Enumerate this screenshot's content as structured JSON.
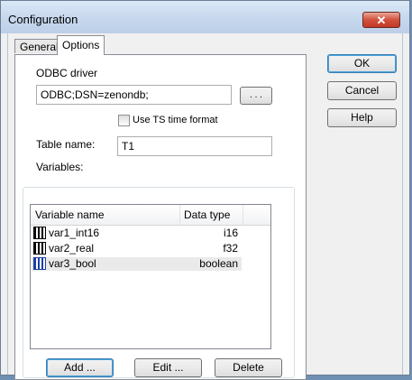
{
  "window": {
    "title": "Configuration",
    "close_glyph": "✕"
  },
  "tabs": {
    "general": "General",
    "options": "Options"
  },
  "odbc": {
    "label": "ODBC driver",
    "value": "ODBC;DSN=zenondb;",
    "browse_label": ". . ."
  },
  "use_ts": {
    "label": "Use TS time format",
    "checked": false
  },
  "table": {
    "label": "Table name:",
    "value": "T1"
  },
  "variables": {
    "group_label": "Variables:",
    "columns": [
      "Variable name",
      "Data type"
    ],
    "rows": [
      {
        "name": "var1_int16",
        "type": "i16",
        "selected": false
      },
      {
        "name": "var2_real",
        "type": "f32",
        "selected": false
      },
      {
        "name": "var3_bool",
        "type": "boolean",
        "selected": true
      }
    ],
    "add_label": "Add ...",
    "edit_label": "Edit ...",
    "delete_label": "Delete"
  },
  "side_buttons": {
    "ok": "OK",
    "cancel": "Cancel",
    "help": "Help"
  },
  "icons": {
    "close": "close-icon",
    "variable": "variable-icon"
  },
  "colors": {
    "close_button": "#c23a27",
    "default_button_border": "#3c7fb1",
    "selected_row": "#eaeaea"
  }
}
